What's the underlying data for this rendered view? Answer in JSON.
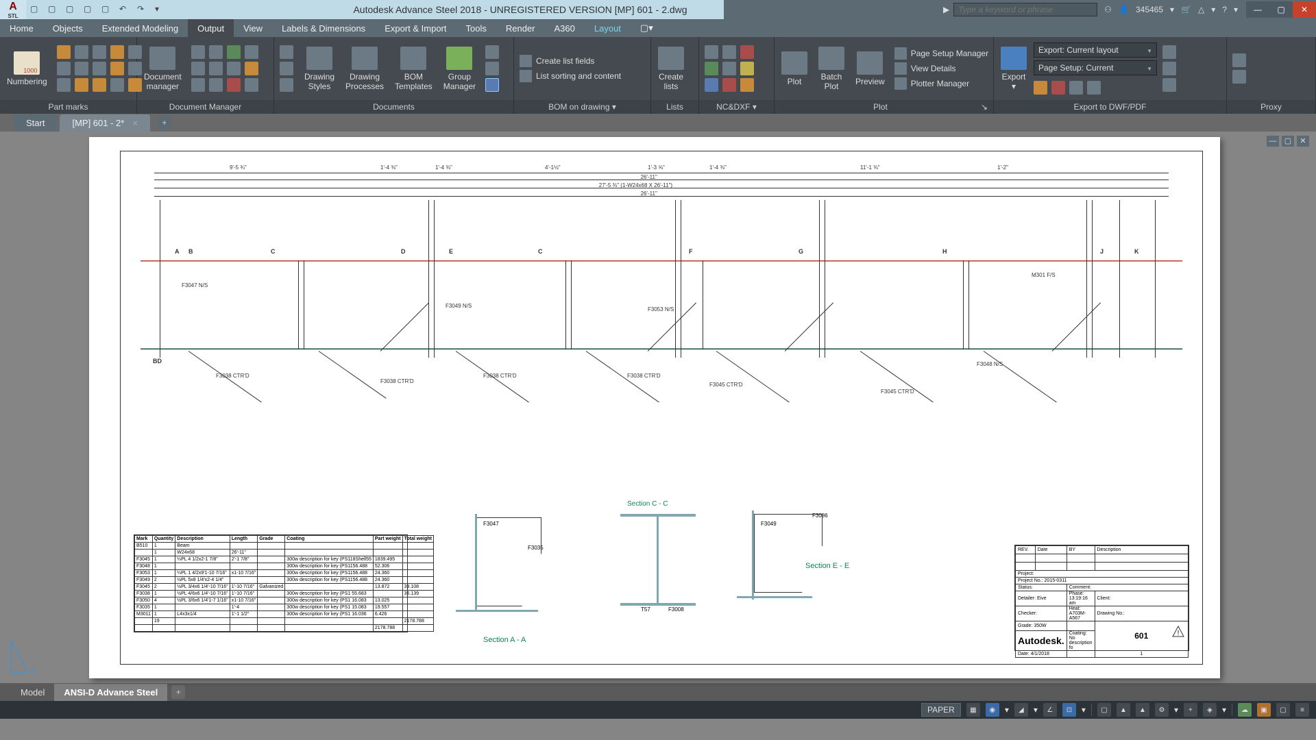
{
  "title": "Autodesk Advance Steel 2018 - UNREGISTERED VERSION   [MP] 601 - 2.dwg",
  "search_placeholder": "Type a keyword or phrase",
  "user_count": "345465",
  "app_stl": "STL",
  "menu": [
    "Home",
    "Objects",
    "Extended Modeling",
    "Output",
    "View",
    "Labels & Dimensions",
    "Export & Import",
    "Tools",
    "Render",
    "A360",
    "Layout"
  ],
  "menu_active": "Output",
  "panels": {
    "numbering": {
      "label": "Numbering",
      "title": "Part marks"
    },
    "docmgr": {
      "label1": "Document",
      "label2": "manager",
      "title": "Document Manager"
    },
    "docs": {
      "title": "Documents",
      "btns": [
        "Drawing\nStyles",
        "Drawing\nProcesses",
        "BOM\nTemplates",
        "Group\nManager"
      ]
    },
    "bom": {
      "title": "BOM on drawing",
      "rows": [
        "Create list fields",
        "List sorting and content"
      ]
    },
    "lists": {
      "title": "Lists",
      "label1": "Create",
      "label2": "lists"
    },
    "ncdxf": {
      "title": "NC&DXF"
    },
    "plot": {
      "title": "Plot",
      "plot": "Plot",
      "batch1": "Batch",
      "batch2": "Plot",
      "preview": "Preview",
      "rows": [
        "Page Setup Manager",
        "View Details",
        "Plotter Manager"
      ]
    },
    "export": {
      "title": "Export to DWF/PDF",
      "label": "Export",
      "dd1": "Export: Current layout",
      "dd2": "Page Setup: Current"
    },
    "proxy": {
      "title": "Proxy"
    }
  },
  "doc_tabs": {
    "start": "Start",
    "active": "[MP] 601 - 2*"
  },
  "model_tabs": {
    "model": "Model",
    "layout": "ANSI-D Advance Steel"
  },
  "status": {
    "paper": "PAPER"
  },
  "dwg": {
    "top_dims": [
      "9'-5 ¾\"",
      "1'-4 ⅜\"",
      "1'-4 ⅜\"",
      "4'-1½\"",
      "1'-3 ⅝\"",
      "1'-4 ⅜\"",
      "11'-1 ⅜\"",
      "1'-2\""
    ],
    "overall_up": "26'-11\"",
    "overall_mid": "27'-5 ⅜\" (1-W24x68 X 26'-11\")",
    "overall_low": "26'-11\"",
    "marks_top": [
      "A",
      "B",
      "C",
      "D",
      "E",
      "C",
      "F",
      "G",
      "H",
      "J",
      "K"
    ],
    "beam_mark": "BD",
    "labels": [
      "F3047 N/S",
      "F3049 N/S",
      "F3053 N/S",
      "M301 F/S",
      "F3038 CTR'D",
      "F3038 CTR'D",
      "F3038 CTR'D",
      "F3038 CTR'D",
      "F3045 CTR'D",
      "F3045 CTR'D",
      "F3048 N/S"
    ],
    "sections": {
      "aa": "Section A - A",
      "cc": "Section C - C",
      "ee": "Section E - E",
      "f3047": "F3047",
      "f3035": "F3035",
      "f3049": "F3049",
      "f3086": "F3086",
      "f3008": "F3008",
      "t57": "T57"
    },
    "bom": {
      "headers": [
        "Mark",
        "Quantity",
        "Description",
        "Length",
        "Grade",
        "Coating",
        "Part weight",
        "Total weight"
      ],
      "rows": [
        [
          "B510",
          "1",
          "Beam",
          "",
          "",
          "",
          "",
          ""
        ],
        [
          "",
          "1",
          "W24x68",
          "26'-11\"",
          "",
          "",
          "",
          ""
        ],
        [
          "F3045",
          "1",
          "¼PL 4 1/2x2-1 7/8\"",
          "2'-1 7/8\"",
          "",
          "300w description for key (PS118Shell55",
          "1839.495",
          ""
        ],
        [
          "F3048",
          "1",
          "",
          "",
          "",
          "300w description for key (PS1156.488",
          "52.306",
          ""
        ],
        [
          "F3053",
          "1",
          "¼PL 1 4/2x9'1-10 7/16\"",
          "x1-10 7/16\"",
          "",
          "300w description for key (PS1156.488",
          "24.360",
          ""
        ],
        [
          "F3049",
          "2",
          "½PL 5x8 1/4'x2-4 1/4\"",
          "",
          "",
          "300w description for key (PS1156.488",
          "24.360",
          ""
        ],
        [
          "F3045",
          "2",
          "½PL 3/4x6 1/4'-10 7/16\"",
          "1'-10 7/16\"",
          "Galvanized",
          "",
          "13.872",
          "39.108"
        ],
        [
          "F3038",
          "1",
          "½PL 4/6x6 1/4'-10 7/16\"",
          "1'-10 7/16\"",
          "",
          "300w description for key (PS1 55.683",
          "",
          "36.139"
        ],
        [
          "F3050",
          "4",
          "½PL 3/6x6 1/4'1-7 1/16\"",
          "x1-10 7/16\"",
          "",
          "300w description for key (PS1 16.083",
          "13.025",
          ""
        ],
        [
          "F3035",
          "1",
          "",
          "1'-4",
          "",
          "300w description for key (PS1 15.083",
          "19.557",
          ""
        ],
        [
          "M3011",
          "1",
          "L4x3x1/4",
          "1'-1 1/2\"",
          "",
          "300w description for key (PS1 16.036",
          "6.426",
          ""
        ],
        [
          "",
          "19",
          "",
          "",
          "",
          "",
          "",
          "2178.788"
        ],
        [
          "",
          "",
          "",
          "",
          "",
          "",
          "2178.788",
          ""
        ]
      ]
    },
    "titleblock": {
      "rev": "REV.",
      "date": "Date",
      "by": "BY",
      "desc": "Description",
      "project": "Project:",
      "projno": "Project No.: 2015-0311",
      "status": "Status:",
      "comment": "Comment:",
      "detailer": "Detailer: Eive",
      "phase": "Phase: 13:19:16 am",
      "client": "Client:",
      "checker": "Checker:",
      "heat": "Heat: A703M-A567",
      "dwgno_l": "Drawing No.:",
      "grade_l": "Grade:",
      "grade_v": "350W",
      "dwgno": "601",
      "logo": "Autodesk.",
      "coating": "Coating: No description fo",
      "scale_v": "1",
      "date_l": "Date:",
      "date_v": "4/1/2018"
    }
  }
}
